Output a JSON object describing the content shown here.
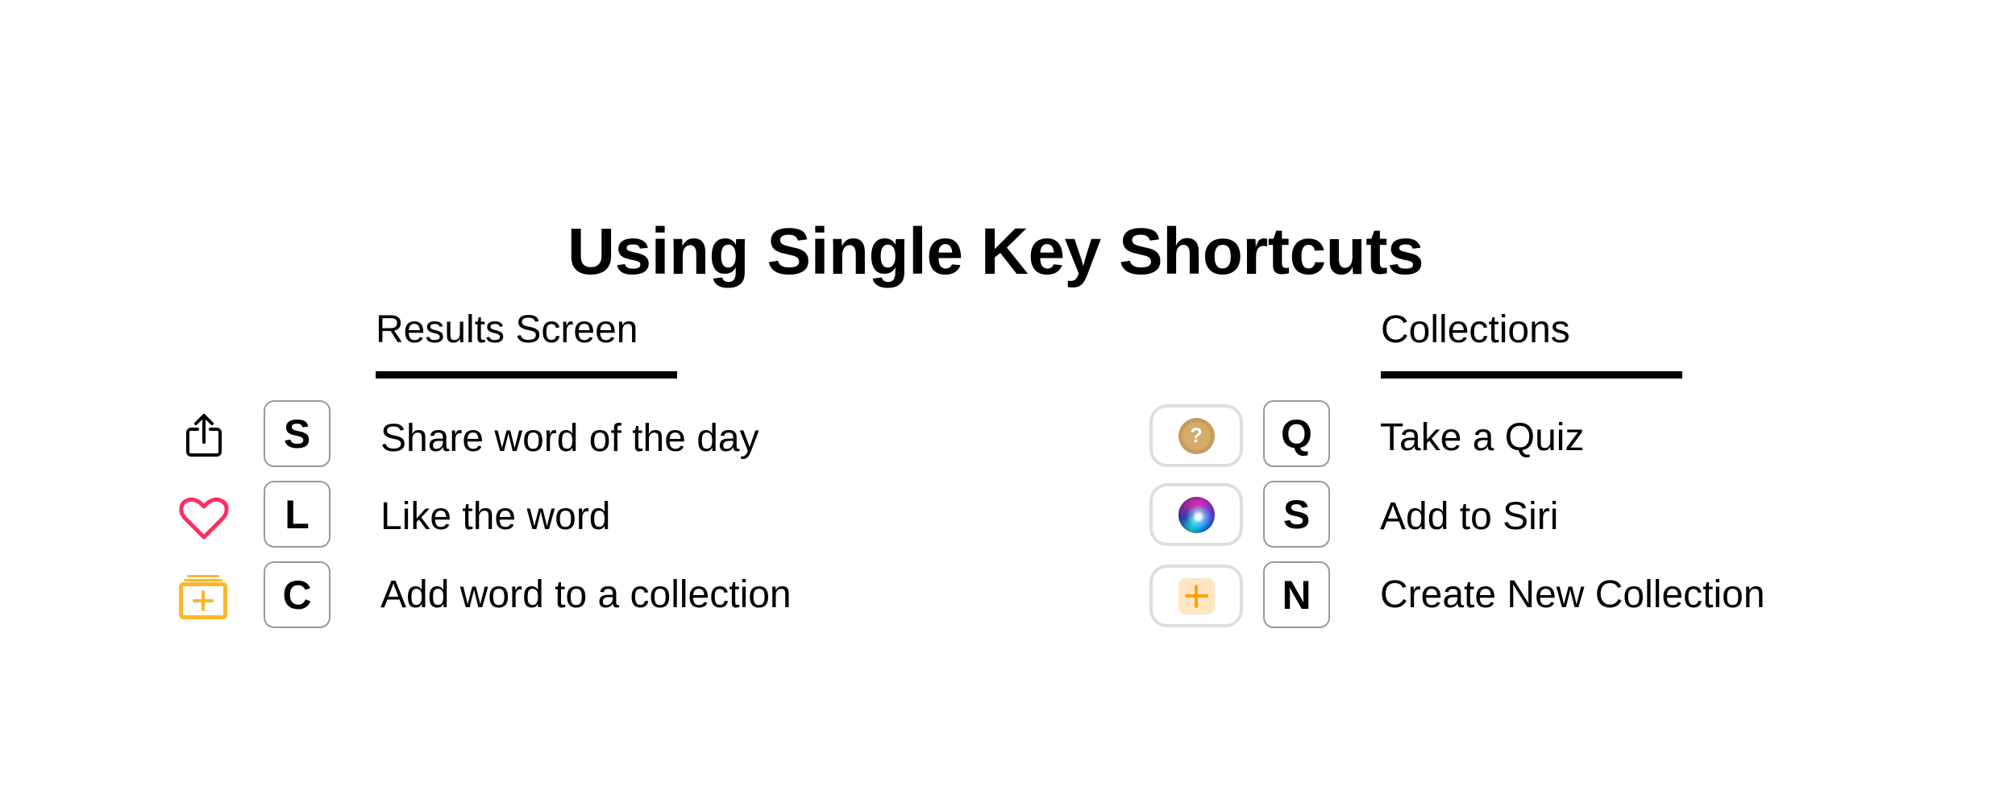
{
  "title": "Using Single Key Shortcuts",
  "colors": {
    "heart": "#FF2D5F",
    "collection_add": "#FBB62A",
    "quiz_coin": "#C89C5A",
    "plus_tile_bg": "#FFE6C0",
    "plus_tile_fg": "#FFA200",
    "key_border": "#9A9A9A",
    "pill_border": "#DEDEDE"
  },
  "sections": [
    {
      "heading": "Results Screen",
      "shortcuts": [
        {
          "icon": "share-icon",
          "key": "S",
          "label": "Share word of the day"
        },
        {
          "icon": "heart-icon",
          "key": "L",
          "label": "Like the word"
        },
        {
          "icon": "add-to-collection-icon",
          "key": "C",
          "label": "Add word to a collection"
        }
      ]
    },
    {
      "heading": "Collections",
      "shortcuts": [
        {
          "icon": "quiz-coin-icon",
          "icon_text": "?",
          "key": "Q",
          "label": "Take a Quiz"
        },
        {
          "icon": "siri-icon",
          "key": "S",
          "label": "Add to Siri"
        },
        {
          "icon": "plus-icon",
          "key": "N",
          "label": "Create New Collection"
        }
      ]
    }
  ]
}
